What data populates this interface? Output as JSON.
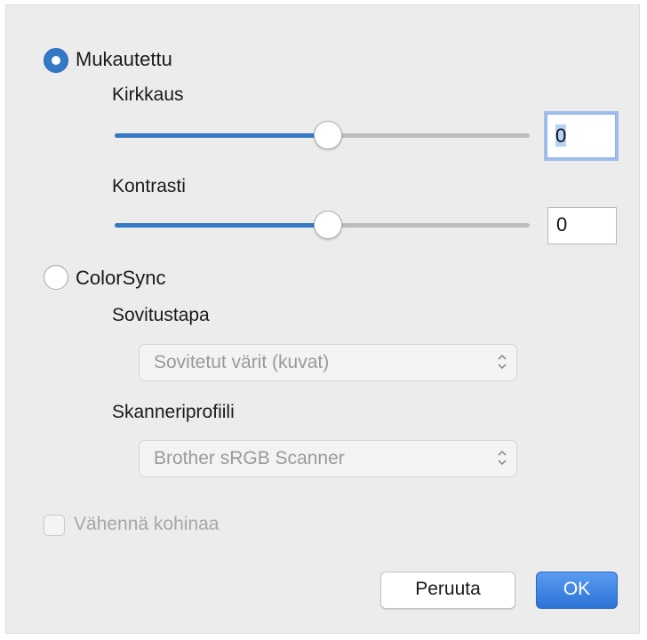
{
  "options": {
    "custom": {
      "label": "Mukautettu",
      "selected": true
    },
    "colorsync": {
      "label": "ColorSync",
      "selected": false
    }
  },
  "brightness": {
    "label": "Kirkkaus",
    "value": "0",
    "slider_fraction": 0.5
  },
  "contrast": {
    "label": "Kontrasti",
    "value": "0",
    "slider_fraction": 0.5
  },
  "matching": {
    "label": "Sovitustapa",
    "selected": "Sovitetut värit (kuvat)"
  },
  "profile": {
    "label": "Skanneriprofiili",
    "selected": "Brother sRGB Scanner"
  },
  "noise": {
    "label": "Vähennä kohinaa",
    "checked": false,
    "enabled": false
  },
  "buttons": {
    "cancel": "Peruuta",
    "ok": "OK"
  },
  "colors": {
    "accent": "#3478c6",
    "window_bg": "#ececec"
  }
}
